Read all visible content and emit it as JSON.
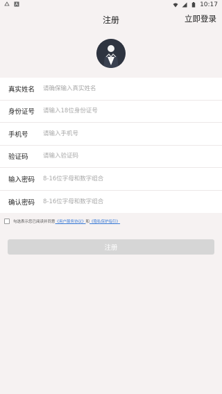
{
  "status_bar": {
    "time": "10:17",
    "icons": [
      "notification-icon",
      "app-icon",
      "wifi-icon",
      "signal-icon",
      "battery-icon"
    ]
  },
  "nav": {
    "title": "注册",
    "login_label": "立即登录"
  },
  "form": {
    "fields": [
      {
        "label": "真实姓名",
        "placeholder": "请确保输入真实姓名"
      },
      {
        "label": "身份证号",
        "placeholder": "请输入18位身份证号"
      },
      {
        "label": "手机号",
        "placeholder": "请输入手机号"
      },
      {
        "label": "验证码",
        "placeholder": "请输入验证码"
      },
      {
        "label": "输入密码",
        "placeholder": "8-16位字母和数字组合"
      },
      {
        "label": "确认密码",
        "placeholder": "8-16位字母和数字组合"
      }
    ]
  },
  "agreement": {
    "prefix": "勾选表示您已阅读并同意",
    "link1": "《用户服务协议》",
    "and": "和",
    "link2": "《隐私保护指引》"
  },
  "submit_label": "注册",
  "colors": {
    "background": "#f6f2f2",
    "link": "#3b7bd6",
    "button_disabled": "#d6d6d6"
  }
}
